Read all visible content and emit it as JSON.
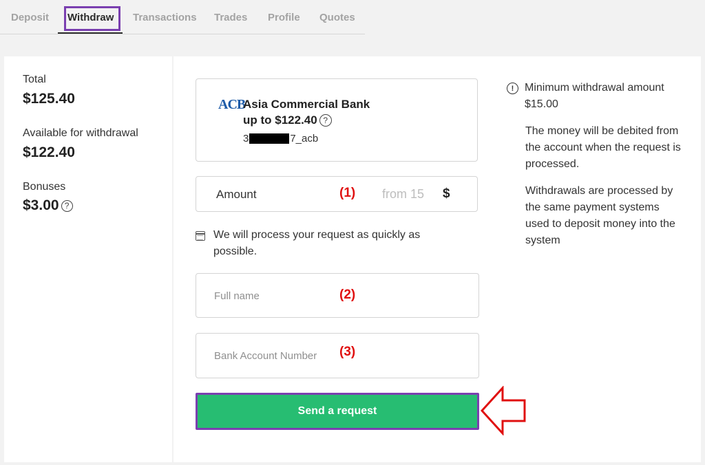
{
  "tabs": [
    {
      "label": "Deposit"
    },
    {
      "label": "Withdraw",
      "active": true
    },
    {
      "label": "Transactions"
    },
    {
      "label": "Trades"
    },
    {
      "label": "Profile"
    },
    {
      "label": "Quotes"
    }
  ],
  "balance": {
    "total_label": "Total",
    "total_value": "$125.40",
    "available_label": "Available for withdrawal",
    "available_value": "$122.40",
    "bonuses_label": "Bonuses",
    "bonuses_value": "$3.00"
  },
  "help_glyph": "?",
  "bank": {
    "logo_text": "ACB",
    "name": "Asia Commercial Bank",
    "limit": "up to $122.40",
    "account_prefix": "3",
    "account_suffix": "7_acb"
  },
  "amount": {
    "label": "Amount",
    "placeholder": "from 15",
    "currency": "$"
  },
  "process_note": "We will process your request as quickly as possible.",
  "fullname": {
    "placeholder": "Full name"
  },
  "bank_account": {
    "placeholder": "Bank Account Number"
  },
  "markers": {
    "one": "(1)",
    "two": "(2)",
    "three": "(3)"
  },
  "send_button": "Send a request",
  "info": {
    "warn_glyph": "!",
    "min_withdrawal": "Minimum withdrawal amount $15.00",
    "debit_note": "The money will be debited from the account when the request is processed.",
    "process_line1": "Withdrawals are processed by the same payment systems",
    "process_line2": "used to deposit money into the system"
  },
  "colors": {
    "accent_highlight": "#7a3fb0",
    "button_green": "#27bd72",
    "annotation_red": "#e01010"
  },
  "icons": [
    "help-icon",
    "calendar-icon",
    "warning-icon",
    "arrow-annotation-icon"
  ]
}
